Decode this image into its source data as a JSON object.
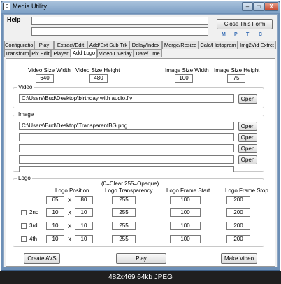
{
  "window": {
    "title": "Media Utility",
    "icon": "S",
    "minimize": "–",
    "maximize": "□",
    "close": "X"
  },
  "menu": {
    "help": "Help"
  },
  "toolbar": {
    "close_form": "Close This Form",
    "m": "M",
    "p": "P",
    "t": "T",
    "c": "C"
  },
  "tabs_row1": [
    "Configuration",
    "Play",
    "Extract/Edit",
    "Add/Ext Sub Trk",
    "Delay/Index",
    "Merge/Resize",
    "Calc/Histogram",
    "Img2Vid Extrct"
  ],
  "tabs_row2": [
    "Transform",
    "Pix Edit",
    "Player",
    "Add Logo",
    "Video Overlay",
    "Date/Time"
  ],
  "active_tab": "Add Logo",
  "sizes": {
    "video_width_label": "Video Size Width",
    "video_width": "640",
    "video_height_label": "Video Size Height",
    "video_height": "480",
    "image_width_label": "Image Size Width",
    "image_width": "100",
    "image_height_label": "Image Size Height",
    "image_height": "75"
  },
  "video": {
    "label": "Video",
    "path": "C:\\Users\\Bud\\Desktop\\birthday with audio.flv",
    "open": "Open"
  },
  "image": {
    "label": "Image",
    "paths": [
      "C:\\Users\\Bud\\Desktop\\TransparentBG.png",
      "",
      "",
      "",
      ""
    ],
    "open": "Open"
  },
  "logo": {
    "label": "Logo",
    "note": "(0=Clear 255=Opaque)",
    "col_position": "Logo Position",
    "col_transparency": "Logo Transparency",
    "col_start": "Logo Frame Start",
    "col_stop": "Logo Frame Stop",
    "x_sep": "X",
    "rows": [
      {
        "name": "",
        "x": "65",
        "y": "80",
        "transparency": "255",
        "start": "100",
        "stop": "200"
      },
      {
        "name": "2nd",
        "x": "10",
        "y": "10",
        "transparency": "255",
        "start": "100",
        "stop": "200"
      },
      {
        "name": "3rd",
        "x": "10",
        "y": "10",
        "transparency": "255",
        "start": "100",
        "stop": "200"
      },
      {
        "name": "4th",
        "x": "10",
        "y": "10",
        "transparency": "255",
        "start": "100",
        "stop": "200"
      }
    ]
  },
  "actions": {
    "create_avs": "Create AVS",
    "play": "Play",
    "make_video": "Make Video"
  },
  "status": {
    "text": "482x469 64kb JPEG"
  }
}
